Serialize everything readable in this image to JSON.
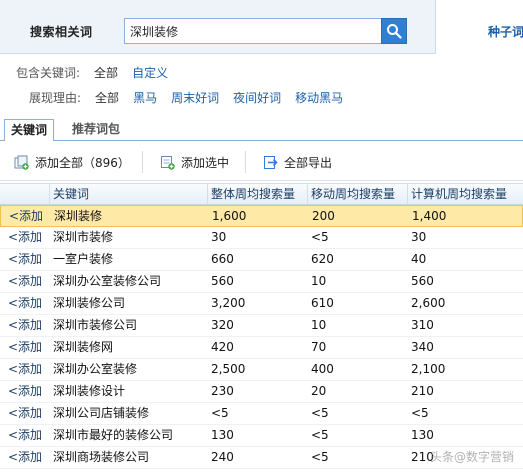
{
  "search": {
    "label": "搜索相关词",
    "value": "深圳装修",
    "seed_tab": "种子词"
  },
  "filters": {
    "include": {
      "label": "包含关键词:",
      "options": [
        "全部",
        "自定义"
      ]
    },
    "reason": {
      "label": "展现理由:",
      "options": [
        "全部",
        "黑马",
        "周末好词",
        "夜间好词",
        "移动黑马"
      ]
    }
  },
  "tabs": [
    "关键词",
    "推荐词包"
  ],
  "toolbar": {
    "add_all": "添加全部（896）",
    "add_selected": "添加选中",
    "export_all": "全部导出"
  },
  "table": {
    "headers": [
      "关键词",
      "整体周均搜索量",
      "移动周均搜索量",
      "计算机周均搜索量"
    ],
    "add_label": "<添加",
    "rows": [
      [
        "深圳装修",
        "1,600",
        "200",
        "1,400"
      ],
      [
        "深圳市装修",
        "30",
        "<5",
        "30"
      ],
      [
        "一室户装修",
        "660",
        "620",
        "40"
      ],
      [
        "深圳办公室装修公司",
        "560",
        "10",
        "560"
      ],
      [
        "深圳装修公司",
        "3,200",
        "610",
        "2,600"
      ],
      [
        "深圳市装修公司",
        "320",
        "10",
        "310"
      ],
      [
        "深圳装修网",
        "420",
        "70",
        "340"
      ],
      [
        "深圳办公室装修",
        "2,500",
        "400",
        "2,100"
      ],
      [
        "深圳装修设计",
        "230",
        "20",
        "210"
      ],
      [
        "深圳公司店铺装修",
        "<5",
        "<5",
        "<5"
      ],
      [
        "深圳市最好的装修公司",
        "130",
        "<5",
        "130"
      ],
      [
        "深圳商场装修公司",
        "240",
        "<5",
        "210"
      ]
    ]
  },
  "watermark": "头条@数字营销"
}
